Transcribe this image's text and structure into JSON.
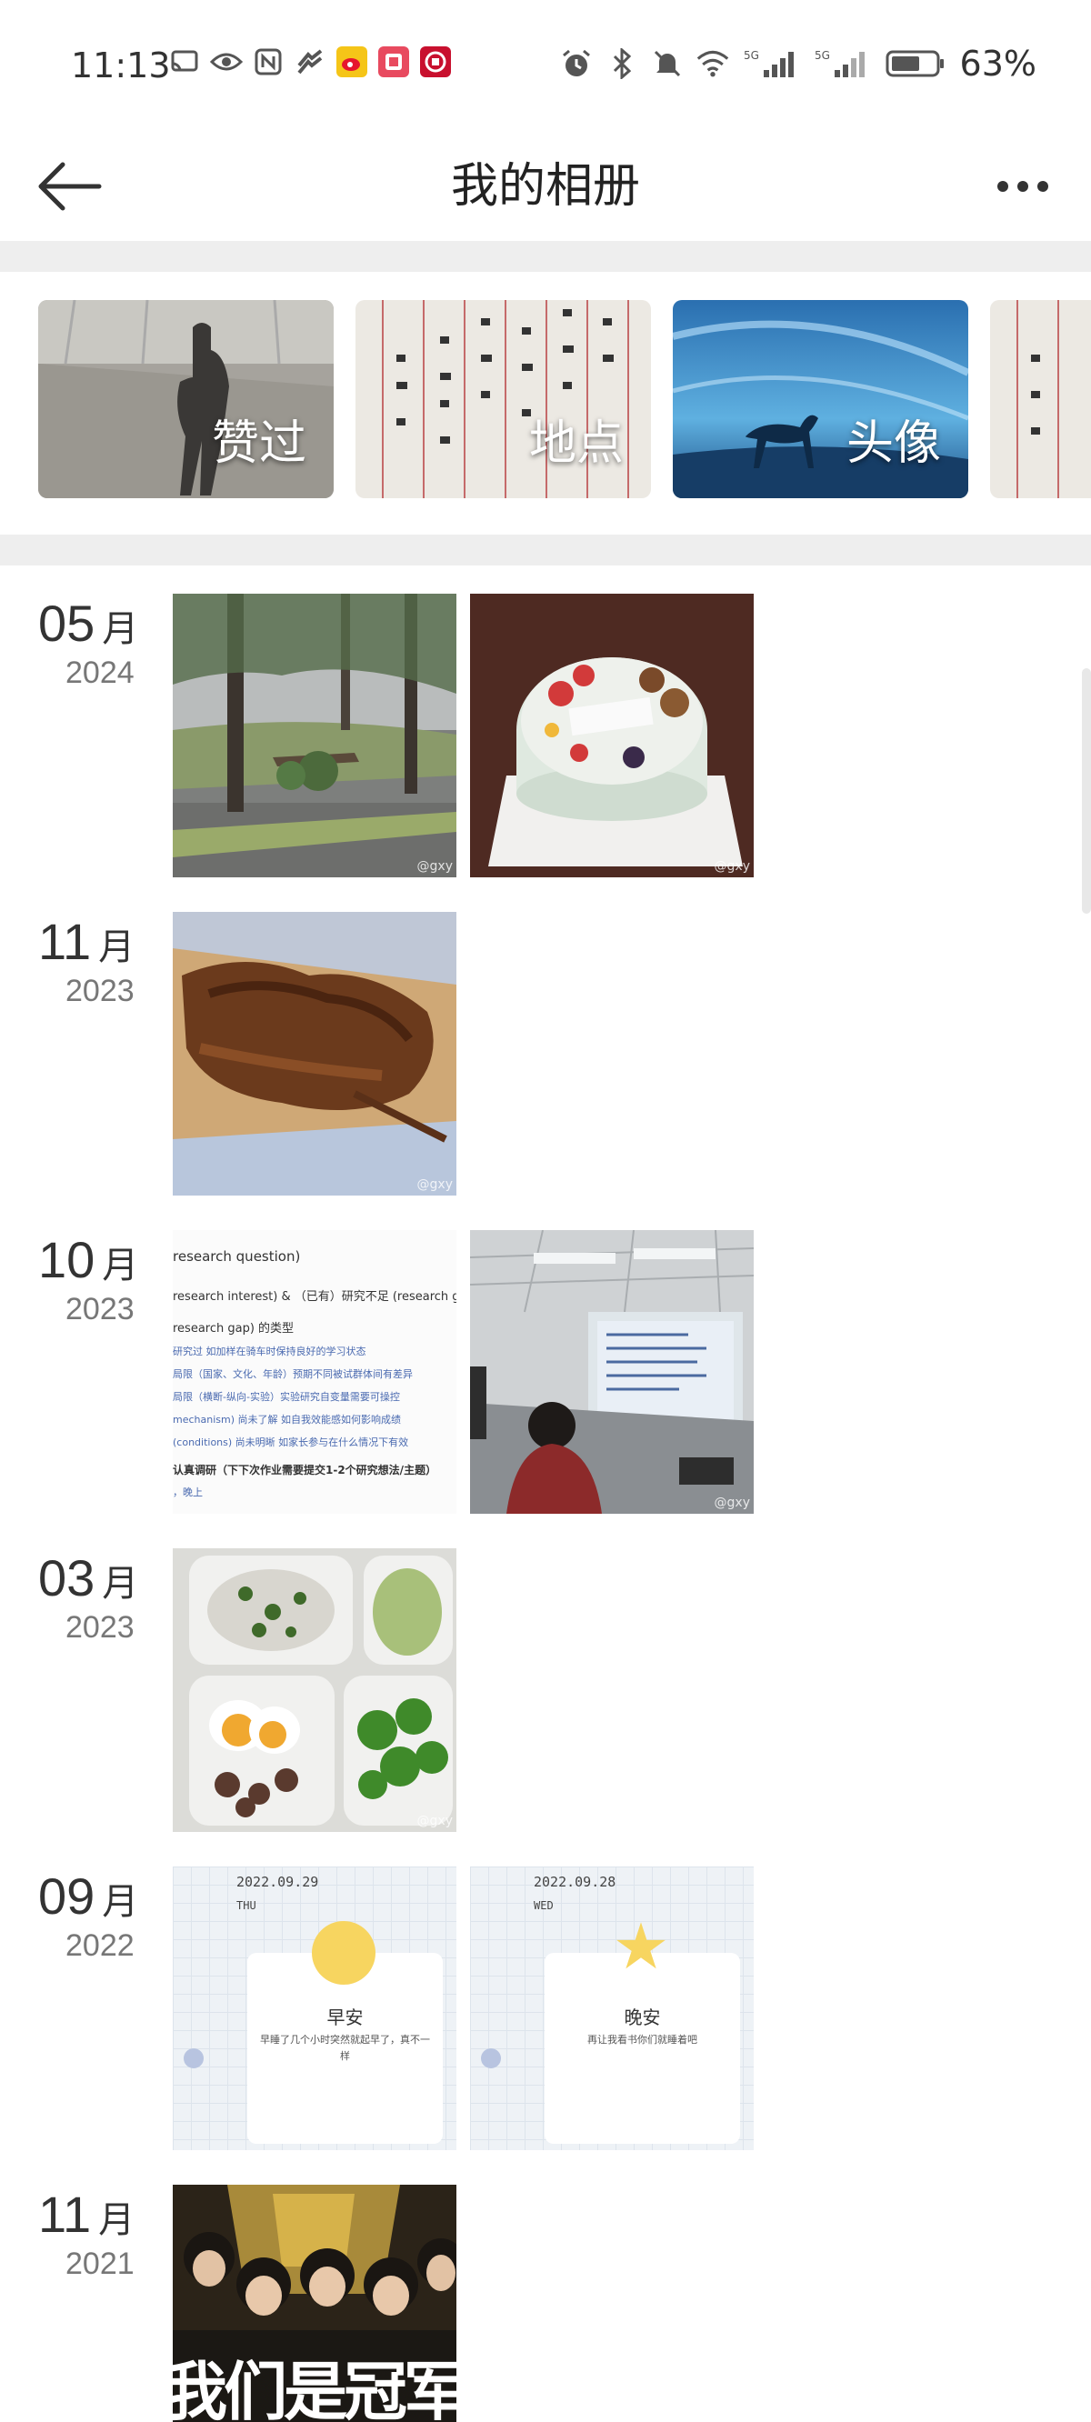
{
  "status_bar": {
    "time": "11:13",
    "battery": "63%"
  },
  "header": {
    "title": "我的相册"
  },
  "albums": [
    {
      "label": "赞过"
    },
    {
      "label": "地点"
    },
    {
      "label": "头像"
    },
    {
      "label": ""
    }
  ],
  "groups": [
    {
      "month": "05",
      "unit": "月",
      "year": "2024",
      "photos": [
        "broken-tree",
        "cake"
      ]
    },
    {
      "month": "11",
      "unit": "月",
      "year": "2023",
      "photos": [
        "grilled-meat"
      ]
    },
    {
      "month": "10",
      "unit": "月",
      "year": "2023",
      "photos": [
        "lecture-slide",
        "classroom"
      ]
    },
    {
      "month": "03",
      "unit": "月",
      "year": "2023",
      "photos": [
        "lunch-box"
      ]
    },
    {
      "month": "09",
      "unit": "月",
      "year": "2022",
      "photos": [
        "morning-card",
        "night-card"
      ]
    },
    {
      "month": "11",
      "unit": "月",
      "year": "2021",
      "photos": [
        "team-poster"
      ]
    }
  ],
  "cards": {
    "morning": {
      "date": "2022.09.29",
      "day": "THU",
      "title": "早安",
      "text": "早睡了几个小时突然就起早了，真不一样"
    },
    "night": {
      "date": "2022.09.28",
      "day": "WED",
      "title": "晚安",
      "text": "再让我看书你们就睡着吧"
    }
  },
  "slide_text": {
    "l1": "research question)",
    "l2": "research interest) & （已有）研究不足 (research gap)",
    "l3": "research gap) 的类型",
    "l4": "研究过 如加样在骑车时保持良好的学习状态",
    "l5": "局限（国家、文化、年龄）预期不同被试群体间有差异",
    "l6": "局限（横断-纵向-实验）实验研究自变量需要可操控",
    "l7": "mechanism) 尚未了解 如自我效能感如何影响成绩",
    "l8": "(conditions) 尚未明晰 如家长参与在什么情况下有效",
    "l9": "认真调研（下下次作业需要提交1-2个研究想法/主题）",
    "l10": "，晚上"
  },
  "poster_text": "我们是冠军",
  "watermark": "@gxy"
}
